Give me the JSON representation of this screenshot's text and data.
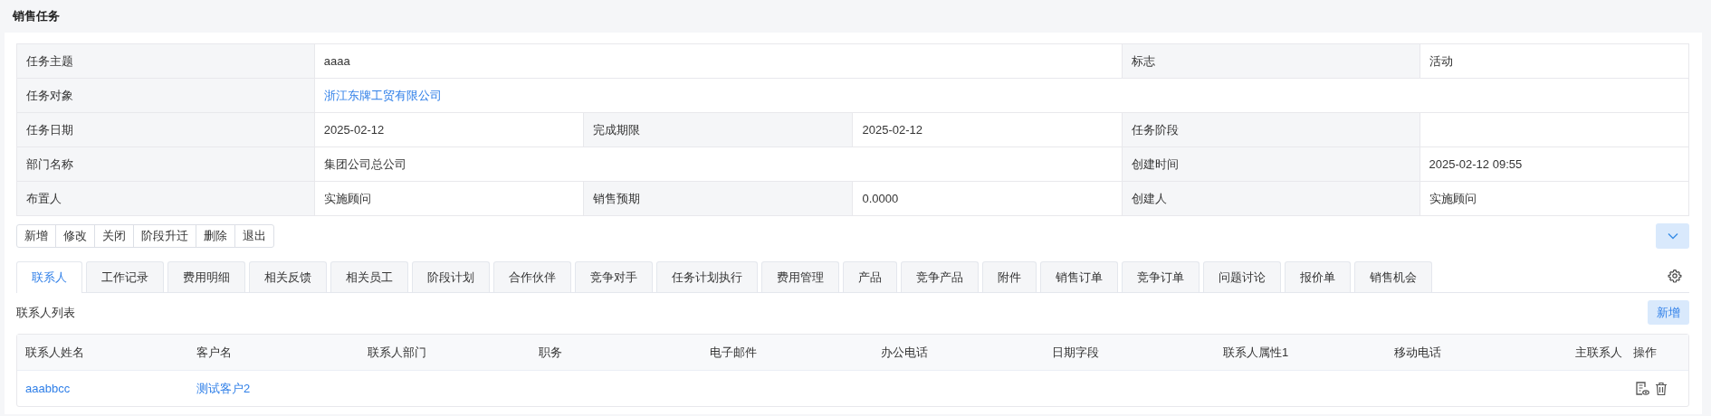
{
  "page_title": "销售任务",
  "details": [
    {
      "fields": [
        {
          "label": "任务主题",
          "value": "aaaa",
          "kind": "text"
        },
        {
          "label": "标志",
          "value": "活动",
          "kind": "text"
        }
      ]
    },
    {
      "fields": [
        {
          "label": "任务对象",
          "value": "浙江东牌工贸有限公司",
          "kind": "link"
        }
      ]
    },
    {
      "fields": [
        {
          "label": "任务日期",
          "value": "2025-02-12",
          "kind": "text"
        },
        {
          "label": "完成期限",
          "value": "2025-02-12",
          "kind": "text"
        },
        {
          "label": "任务阶段",
          "kind": "text"
        }
      ]
    },
    {
      "fields": [
        {
          "label": "部门名称",
          "value": "集团公司总公司",
          "kind": "text"
        },
        {
          "label": "创建时间",
          "value": "2025-02-12 09:55",
          "kind": "text"
        }
      ]
    },
    {
      "fields": [
        {
          "label": "布置人",
          "value": "实施顾问",
          "kind": "text"
        },
        {
          "label": "销售预期",
          "value": "0.0000",
          "kind": "text"
        },
        {
          "label": "创建人",
          "value": "实施顾问",
          "kind": "text"
        }
      ]
    }
  ],
  "actions": [
    "新增",
    "修改",
    "关闭",
    "阶段升迁",
    "删除",
    "退出"
  ],
  "tabs": [
    {
      "label": "联系人",
      "selected": true
    },
    {
      "label": "工作记录",
      "selected": false
    },
    {
      "label": "费用明细",
      "selected": false
    },
    {
      "label": "相关反馈",
      "selected": false
    },
    {
      "label": "相关员工",
      "selected": false
    },
    {
      "label": "阶段计划",
      "selected": false
    },
    {
      "label": "合作伙伴",
      "selected": false
    },
    {
      "label": "竞争对手",
      "selected": false
    },
    {
      "label": "任务计划执行",
      "selected": false
    },
    {
      "label": "费用管理",
      "selected": false
    },
    {
      "label": "产品",
      "selected": false
    },
    {
      "label": "竞争产品",
      "selected": false
    },
    {
      "label": "附件",
      "selected": false
    },
    {
      "label": "销售订单",
      "selected": false
    },
    {
      "label": "竞争订单",
      "selected": false
    },
    {
      "label": "问题讨论",
      "selected": false
    },
    {
      "label": "报价单",
      "selected": false
    },
    {
      "label": "销售机会",
      "selected": false
    }
  ],
  "list": {
    "title": "联系人列表",
    "add_button": "新增",
    "columns": [
      "联系人姓名",
      "客户名",
      "联系人部门",
      "职务",
      "电子邮件",
      "办公电话",
      "日期字段",
      "联系人属性1",
      "移动电话",
      "主联系人",
      "操作"
    ],
    "rows": [
      {
        "cells": [
          {
            "text": "aaabbcc",
            "kind": "link"
          },
          {
            "text": "测试客户2",
            "kind": "link"
          }
        ]
      }
    ]
  }
}
